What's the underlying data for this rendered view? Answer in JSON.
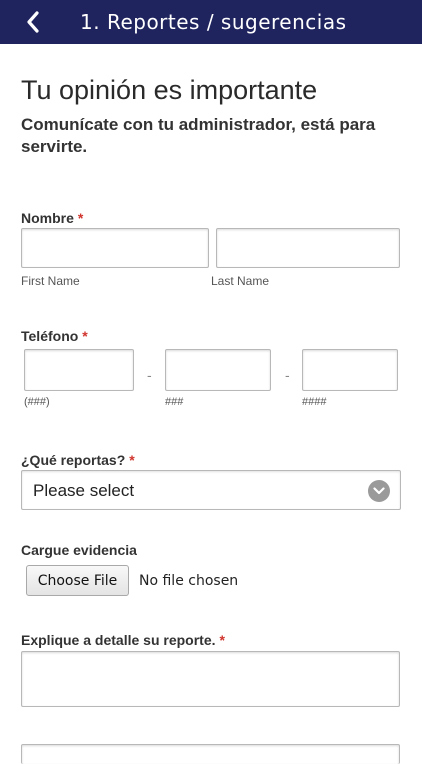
{
  "header": {
    "back_icon": "chevron-left-icon",
    "title": "1. Reportes / sugerencias"
  },
  "form": {
    "heading": "Tu opinión es importante",
    "subheading": "Comunícate con tu administrador, está para servirte.",
    "nombre": {
      "label": "Nombre",
      "required_mark": "*",
      "first_sublabel": "First Name",
      "last_sublabel": "Last Name",
      "first_value": "",
      "last_value": ""
    },
    "telefono": {
      "label": "Teléfono",
      "required_mark": "*",
      "area_sublabel": "(###)",
      "prefix_sublabel": "###",
      "line_sublabel": "####",
      "separator": "-"
    },
    "reporta": {
      "label": "¿Qué reportas?",
      "required_mark": "*",
      "selected": "Please select",
      "icon": "chevron-down-circle-icon"
    },
    "evidencia": {
      "label": "Cargue evidencia",
      "button_label": "Choose File",
      "status": "No file chosen"
    },
    "detalle": {
      "label": "Explique a detalle su reporte.",
      "required_mark": "*",
      "value": ""
    }
  },
  "colors": {
    "topbar": "#1f235e",
    "required": "#d0342c"
  }
}
